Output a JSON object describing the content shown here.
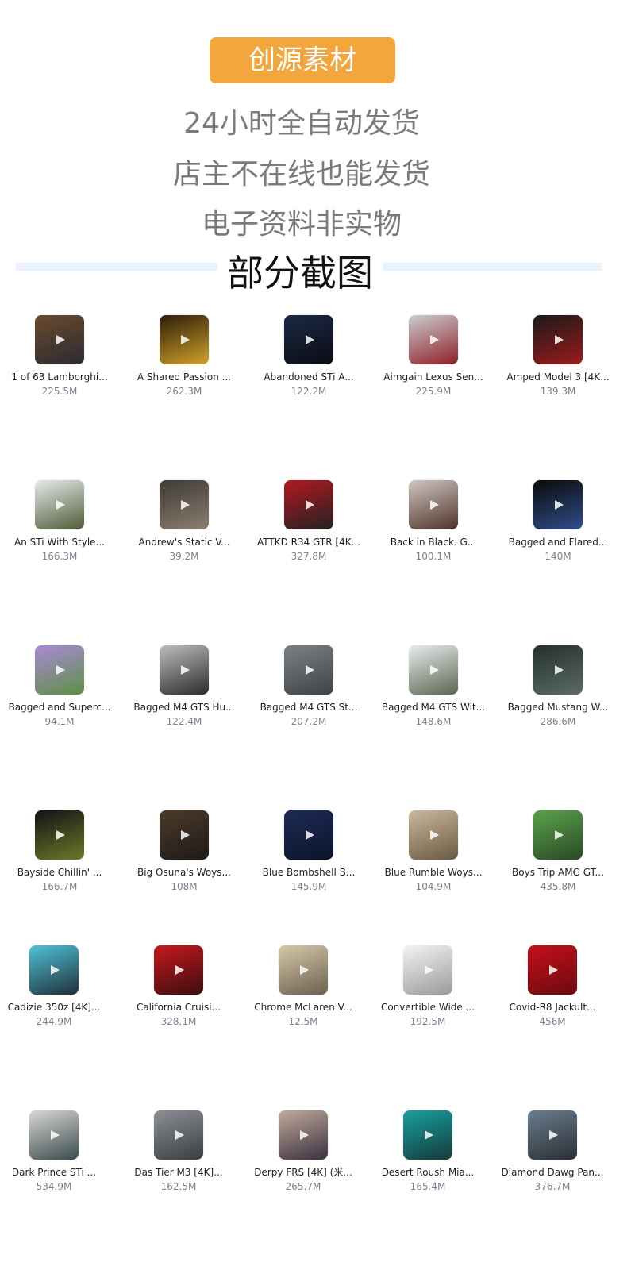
{
  "header": {
    "badge": "创源素材",
    "lines": [
      "24小时全自动发货",
      "店主不在线也能发货",
      "电子资料非实物"
    ],
    "section_title": "部分截图"
  },
  "items": [
    {
      "name": "1 of 63 Lamborghi...",
      "size": "225.5M",
      "colors": [
        "#6a4a2c",
        "#2b2b34"
      ]
    },
    {
      "name": "A Shared Passion ...",
      "size": "262.3M",
      "colors": [
        "#2b1c08",
        "#d2a22c"
      ]
    },
    {
      "name": "Abandoned STi A...",
      "size": "122.2M",
      "colors": [
        "#1b2846",
        "#0b0c12"
      ]
    },
    {
      "name": "Aimgain Lexus Sen...",
      "size": "225.9M",
      "colors": [
        "#c9ccd0",
        "#8f2026"
      ]
    },
    {
      "name": "Amped Model 3 [4K...",
      "size": "139.3M",
      "colors": [
        "#1a1a1a",
        "#9b1b1b"
      ]
    },
    {
      "name": "An STi With Style...",
      "size": "166.3M",
      "colors": [
        "#e8eaec",
        "#4e5b36"
      ]
    },
    {
      "name": "Andrew's Static V...",
      "size": "39.2M",
      "colors": [
        "#3e3a36",
        "#8c7e70"
      ]
    },
    {
      "name": "ATTKD R34 GTR [4K...",
      "size": "327.8M",
      "colors": [
        "#b21820",
        "#222222"
      ]
    },
    {
      "name": "Back in Black. G...",
      "size": "100.1M",
      "colors": [
        "#cfc6c0",
        "#4e3328"
      ]
    },
    {
      "name": "Bagged and Flared...",
      "size": "140M",
      "colors": [
        "#0a0a0a",
        "#2f4e8a"
      ]
    },
    {
      "name": "Bagged and Superc...",
      "size": "94.1M",
      "colors": [
        "#a98ad8",
        "#5e8f42"
      ]
    },
    {
      "name": "Bagged M4 GTS Hu...",
      "size": "122.4M",
      "colors": [
        "#bdbdbd",
        "#2b2b2b"
      ]
    },
    {
      "name": "Bagged M4 GTS St...",
      "size": "207.2M",
      "colors": [
        "#7c8284",
        "#3c4246"
      ]
    },
    {
      "name": "Bagged M4 GTS Wit...",
      "size": "148.6M",
      "colors": [
        "#e9ecef",
        "#5b6650"
      ]
    },
    {
      "name": "Bagged Mustang W...",
      "size": "286.6M",
      "colors": [
        "#23302c",
        "#5c6b66"
      ]
    },
    {
      "name": "Bayside Chillin' ...",
      "size": "166.7M",
      "colors": [
        "#121212",
        "#6a7a2c"
      ]
    },
    {
      "name": "Big Osuna's Woys...",
      "size": "108M",
      "colors": [
        "#4c3a2a",
        "#1e1a18"
      ]
    },
    {
      "name": "Blue Bombshell B...",
      "size": "145.9M",
      "colors": [
        "#1c2a56",
        "#0d1428"
      ]
    },
    {
      "name": "Blue Rumble Woys...",
      "size": "104.9M",
      "colors": [
        "#c9b89c",
        "#6b5a44"
      ]
    },
    {
      "name": "Boys Trip AMG GT...",
      "size": "435.8M",
      "colors": [
        "#5aa24a",
        "#2b4a26"
      ]
    },
    {
      "name": "Cadizie 350z [4K]...",
      "size": "244.9M",
      "colors": [
        "#4ec2d8",
        "#20303a"
      ]
    },
    {
      "name": "California Cruisi...",
      "size": "328.1M",
      "colors": [
        "#c8181c",
        "#3a0e10"
      ]
    },
    {
      "name": "Chrome McLaren V...",
      "size": "12.5M",
      "colors": [
        "#d6c8a8",
        "#6b6050"
      ]
    },
    {
      "name": "Convertible Wide ...",
      "size": "192.5M",
      "colors": [
        "#f4f4f4",
        "#9a9a9a"
      ]
    },
    {
      "name": "Covid-R8 Jackult...",
      "size": "456M",
      "colors": [
        "#c4101a",
        "#6a0a10"
      ]
    },
    {
      "name": "Dark Prince STi ...",
      "size": "534.9M",
      "colors": [
        "#d8d8d2",
        "#3a4a4e"
      ]
    },
    {
      "name": "Das Tier M3 [4K]...",
      "size": "162.5M",
      "colors": [
        "#8c9094",
        "#3a3e42"
      ]
    },
    {
      "name": "Derpy FRS [4K] (米...",
      "size": "265.7M",
      "colors": [
        "#c0aa9a",
        "#3a3040"
      ]
    },
    {
      "name": "Desert Roush Mia...",
      "size": "165.4M",
      "colors": [
        "#18a0a0",
        "#163a3c"
      ]
    },
    {
      "name": "Diamond Dawg Pan...",
      "size": "376.7M",
      "colors": [
        "#6a7e8e",
        "#2a2e34"
      ]
    }
  ]
}
